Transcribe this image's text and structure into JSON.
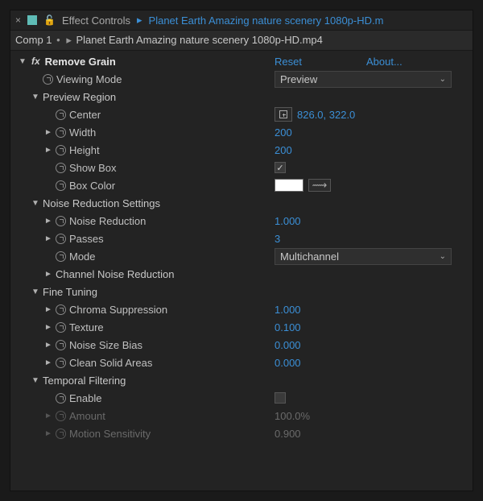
{
  "tab": {
    "label": "Effect Controls",
    "breadcrumb": "Planet Earth  Amazing nature scenery 1080p-HD.m"
  },
  "comp": {
    "name": "Comp 1",
    "layer": "Planet Earth  Amazing nature scenery 1080p-HD.mp4"
  },
  "effect": {
    "name": "Remove Grain",
    "reset": "Reset",
    "about": "About...",
    "viewing_mode": {
      "label": "Viewing Mode",
      "value": "Preview"
    },
    "preview_region": {
      "label": "Preview Region",
      "center": {
        "label": "Center",
        "value": "826.0, 322.0"
      },
      "width": {
        "label": "Width",
        "value": "200"
      },
      "height": {
        "label": "Height",
        "value": "200"
      },
      "show_box": {
        "label": "Show Box",
        "checked": true
      },
      "box_color": {
        "label": "Box Color",
        "value": "#ffffff"
      }
    },
    "noise_reduction_settings": {
      "label": "Noise Reduction Settings",
      "noise_reduction": {
        "label": "Noise Reduction",
        "value": "1.000"
      },
      "passes": {
        "label": "Passes",
        "value": "3"
      },
      "mode": {
        "label": "Mode",
        "value": "Multichannel"
      },
      "channel_nr": {
        "label": "Channel Noise Reduction"
      }
    },
    "fine_tuning": {
      "label": "Fine Tuning",
      "chroma_suppression": {
        "label": "Chroma Suppression",
        "value": "1.000"
      },
      "texture": {
        "label": "Texture",
        "value": "0.100"
      },
      "noise_size_bias": {
        "label": "Noise Size Bias",
        "value": "0.000"
      },
      "clean_solid_areas": {
        "label": "Clean Solid Areas",
        "value": "0.000"
      }
    },
    "temporal_filtering": {
      "label": "Temporal Filtering",
      "enable": {
        "label": "Enable",
        "checked": false
      },
      "amount": {
        "label": "Amount",
        "value": "100.0%"
      },
      "motion_sensitivity": {
        "label": "Motion Sensitivity",
        "value": "0.900"
      }
    }
  }
}
